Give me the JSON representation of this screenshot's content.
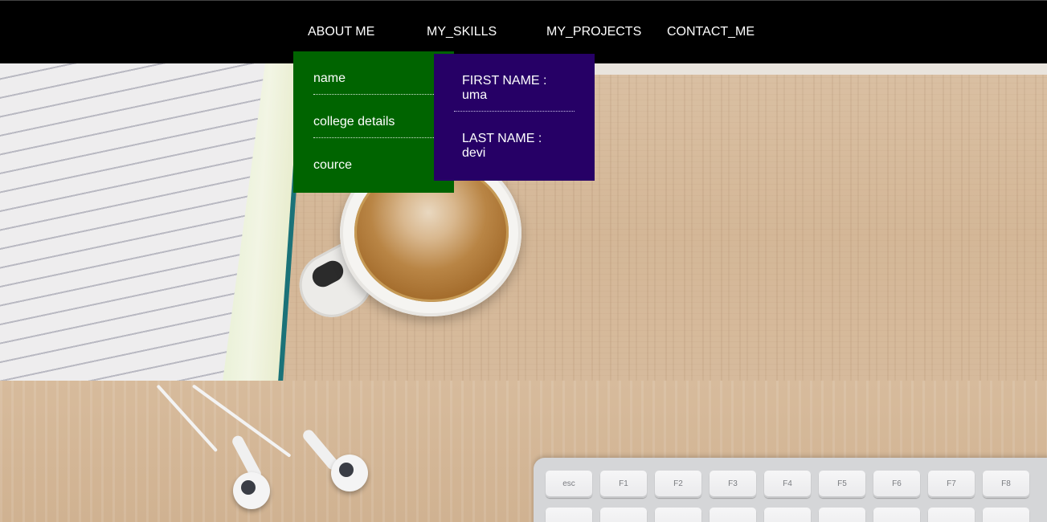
{
  "nav": {
    "items": [
      {
        "label": "ABOUT ME"
      },
      {
        "label": "MY_SKILLS"
      },
      {
        "label": "MY_PROJECTS"
      },
      {
        "label": "CONTACT_ME"
      }
    ]
  },
  "about_dropdown": {
    "items": [
      {
        "label": "name"
      },
      {
        "label": "college details"
      },
      {
        "label": "cource"
      }
    ]
  },
  "name_submenu": {
    "first_name_label": "FIRST NAME :",
    "first_name_value": "uma",
    "last_name_label": "LAST NAME :",
    "last_name_value": "devi"
  },
  "keyboard": {
    "keys": [
      "esc",
      "F1",
      "F2",
      "F3",
      "F4",
      "F5",
      "F6",
      "F7",
      "F8"
    ]
  },
  "colors": {
    "navbar": "#000000",
    "about_dropdown": "#006400",
    "name_submenu": "#260066",
    "text": "#ffffff"
  }
}
